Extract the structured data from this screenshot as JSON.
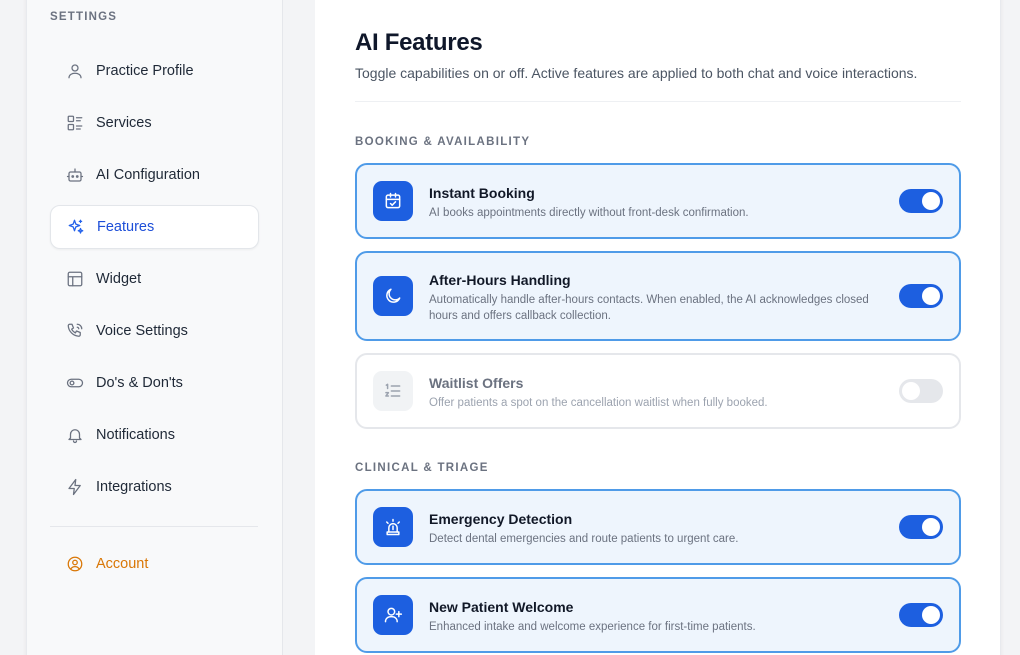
{
  "sidebar": {
    "title": "SETTINGS",
    "items": [
      {
        "label": "Practice Profile",
        "icon": "user-icon"
      },
      {
        "label": "Services",
        "icon": "list-icon"
      },
      {
        "label": "AI Configuration",
        "icon": "robot-icon"
      },
      {
        "label": "Features",
        "icon": "sparkles-icon",
        "active": true
      },
      {
        "label": "Widget",
        "icon": "layout-icon"
      },
      {
        "label": "Voice Settings",
        "icon": "phone-icon"
      },
      {
        "label": "Do's & Don'ts",
        "icon": "toggle-icon"
      },
      {
        "label": "Notifications",
        "icon": "bell-icon"
      },
      {
        "label": "Integrations",
        "icon": "bolt-icon"
      }
    ],
    "account": {
      "label": "Account",
      "icon": "account-circle-icon"
    }
  },
  "main": {
    "title": "AI Features",
    "subtitle": "Toggle capabilities on or off. Active features are applied to both chat and voice interactions.",
    "sections": [
      {
        "label": "BOOKING & AVAILABILITY",
        "features": [
          {
            "name": "Instant Booking",
            "description": "AI books appointments directly without front-desk confirmation.",
            "enabled": true,
            "icon": "calendar-check-icon"
          },
          {
            "name": "After-Hours Handling",
            "description": "Automatically handle after-hours contacts. When enabled, the AI acknowledges closed hours and offers callback collection.",
            "enabled": true,
            "icon": "moon-icon"
          },
          {
            "name": "Waitlist Offers",
            "description": "Offer patients a spot on the cancellation waitlist when fully booked.",
            "enabled": false,
            "icon": "numbered-list-icon"
          }
        ]
      },
      {
        "label": "CLINICAL & TRIAGE",
        "features": [
          {
            "name": "Emergency Detection",
            "description": "Detect dental emergencies and route patients to urgent care.",
            "enabled": true,
            "icon": "siren-icon"
          },
          {
            "name": "New Patient Welcome",
            "description": "Enhanced intake and welcome experience for first-time patients.",
            "enabled": true,
            "icon": "user-plus-icon"
          }
        ]
      }
    ]
  },
  "colors": {
    "accent": "#1d5fe0",
    "accent_border": "#4f9be8",
    "active_bg": "#eef5fd",
    "account": "#d97706"
  }
}
